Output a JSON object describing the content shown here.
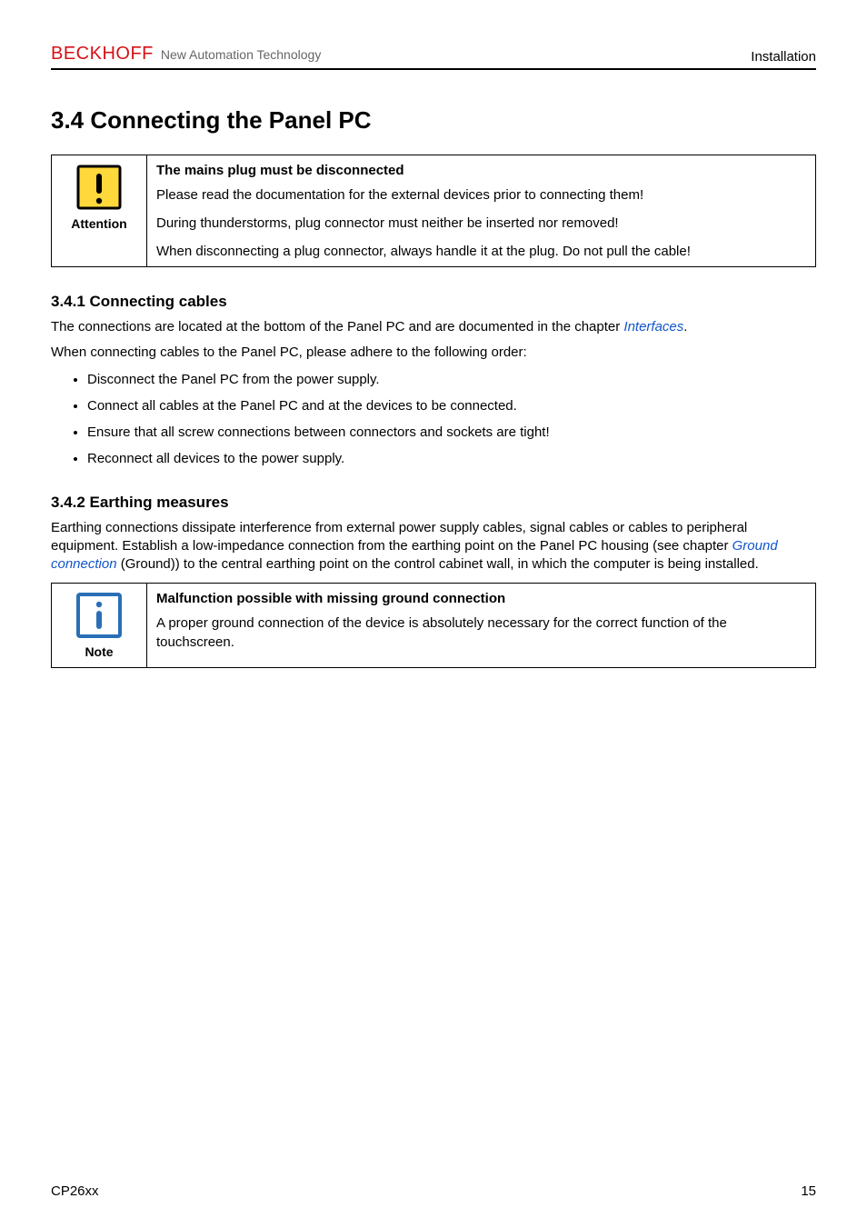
{
  "header": {
    "brand_name": "BECKHOFF",
    "brand_tagline": "New Automation Technology",
    "right": "Installation"
  },
  "section": {
    "number_title": "3.4 Connecting the Panel PC"
  },
  "attention_box": {
    "label": "Attention",
    "title": "The mains plug must be disconnected",
    "line1": "Please read the documentation for the external devices prior to connecting them!",
    "line2": "During thunderstorms, plug connector must neither be inserted nor removed!",
    "line3": "When disconnecting a plug connector, always handle it at the plug. Do not pull the cable!"
  },
  "sub1": {
    "title": "3.4.1 Connecting cables",
    "p1a": "The connections are located at the bottom of the Panel PC and are documented in the chapter ",
    "p1_link": "Interfaces",
    "p1b": ".",
    "p2": "When connecting cables to the Panel PC, please adhere to the following order:",
    "bullets": [
      "Disconnect the Panel PC from the power supply.",
      "Connect all cables at the Panel PC and at the devices to be connected.",
      "Ensure that all screw connections between connectors and sockets are tight!",
      "Reconnect all devices to the power supply."
    ]
  },
  "sub2": {
    "title": "3.4.2 Earthing measures",
    "p1a": "Earthing connections dissipate interference from external power supply cables, signal cables or cables to peripheral equipment. Establish a low-impedance connection from the earthing point on the Panel PC housing (see chapter ",
    "p1_link": "Ground connection",
    "p1b": " (Ground)) to the central earthing point on the control cabinet wall, in which the computer is being installed."
  },
  "note_box": {
    "label": "Note",
    "title": "Malfunction possible with missing ground connection",
    "body": "A proper ground connection of the device is absolutely necessary for the correct function of the touchscreen."
  },
  "footer": {
    "left": "CP26xx",
    "right": "15"
  }
}
